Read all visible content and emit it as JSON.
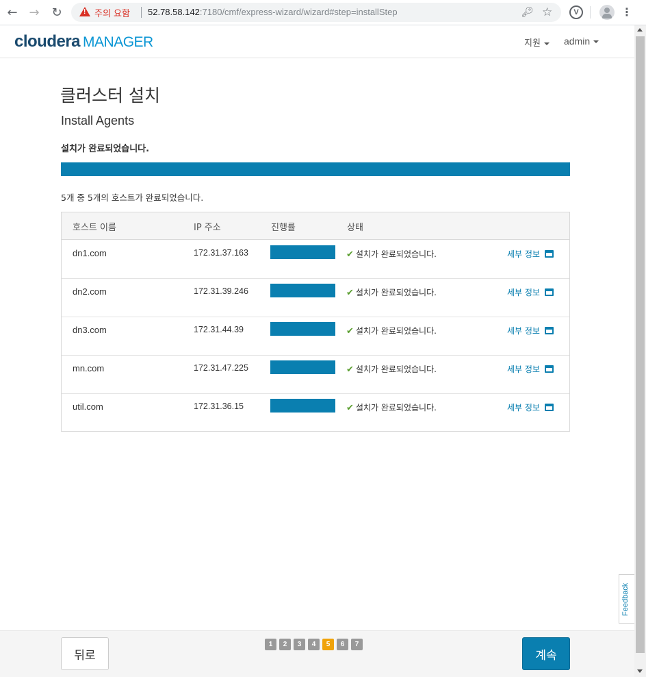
{
  "browser": {
    "security_warning": "주의 요함",
    "url_host": "52.78.58.142",
    "url_path": ":7180/cmf/express-wizard/wizard#step=installStep"
  },
  "header": {
    "logo_main": "cloudera",
    "logo_sub": "MANAGER",
    "support_label": "지원",
    "user_label": "admin"
  },
  "page": {
    "title": "클러스터 설치",
    "subtitle": "Install Agents",
    "status_message": "설치가 완료되었습니다.",
    "overall_progress": 1.0,
    "hosts_summary": "5개 중 5개의 호스트가 완료되었습니다."
  },
  "table": {
    "columns": [
      "호스트 이름",
      "IP 주소",
      "진행률",
      "상태"
    ],
    "rows": [
      {
        "host": "dn1.com",
        "ip": "172.31.37.163",
        "progress": 1.0,
        "status": "설치가 완료되었습니다.",
        "detail": "세부 정보"
      },
      {
        "host": "dn2.com",
        "ip": "172.31.39.246",
        "progress": 1.0,
        "status": "설치가 완료되었습니다.",
        "detail": "세부 정보"
      },
      {
        "host": "dn3.com",
        "ip": "172.31.44.39",
        "progress": 1.0,
        "status": "설치가 완료되었습니다.",
        "detail": "세부 정보"
      },
      {
        "host": "mn.com",
        "ip": "172.31.47.225",
        "progress": 1.0,
        "status": "설치가 완료되었습니다.",
        "detail": "세부 정보"
      },
      {
        "host": "util.com",
        "ip": "172.31.36.15",
        "progress": 1.0,
        "status": "설치가 완료되었습니다.",
        "detail": "세부 정보"
      }
    ]
  },
  "feedback_label": "Feedback",
  "footer": {
    "back_label": "뒤로",
    "continue_label": "계속",
    "steps": [
      "1",
      "2",
      "3",
      "4",
      "5",
      "6",
      "7"
    ],
    "active_step": "5"
  },
  "colors": {
    "accent": "#0a7fb0",
    "active_step": "#f0a30a",
    "success": "#5a9e2f",
    "warning": "#d93025"
  }
}
